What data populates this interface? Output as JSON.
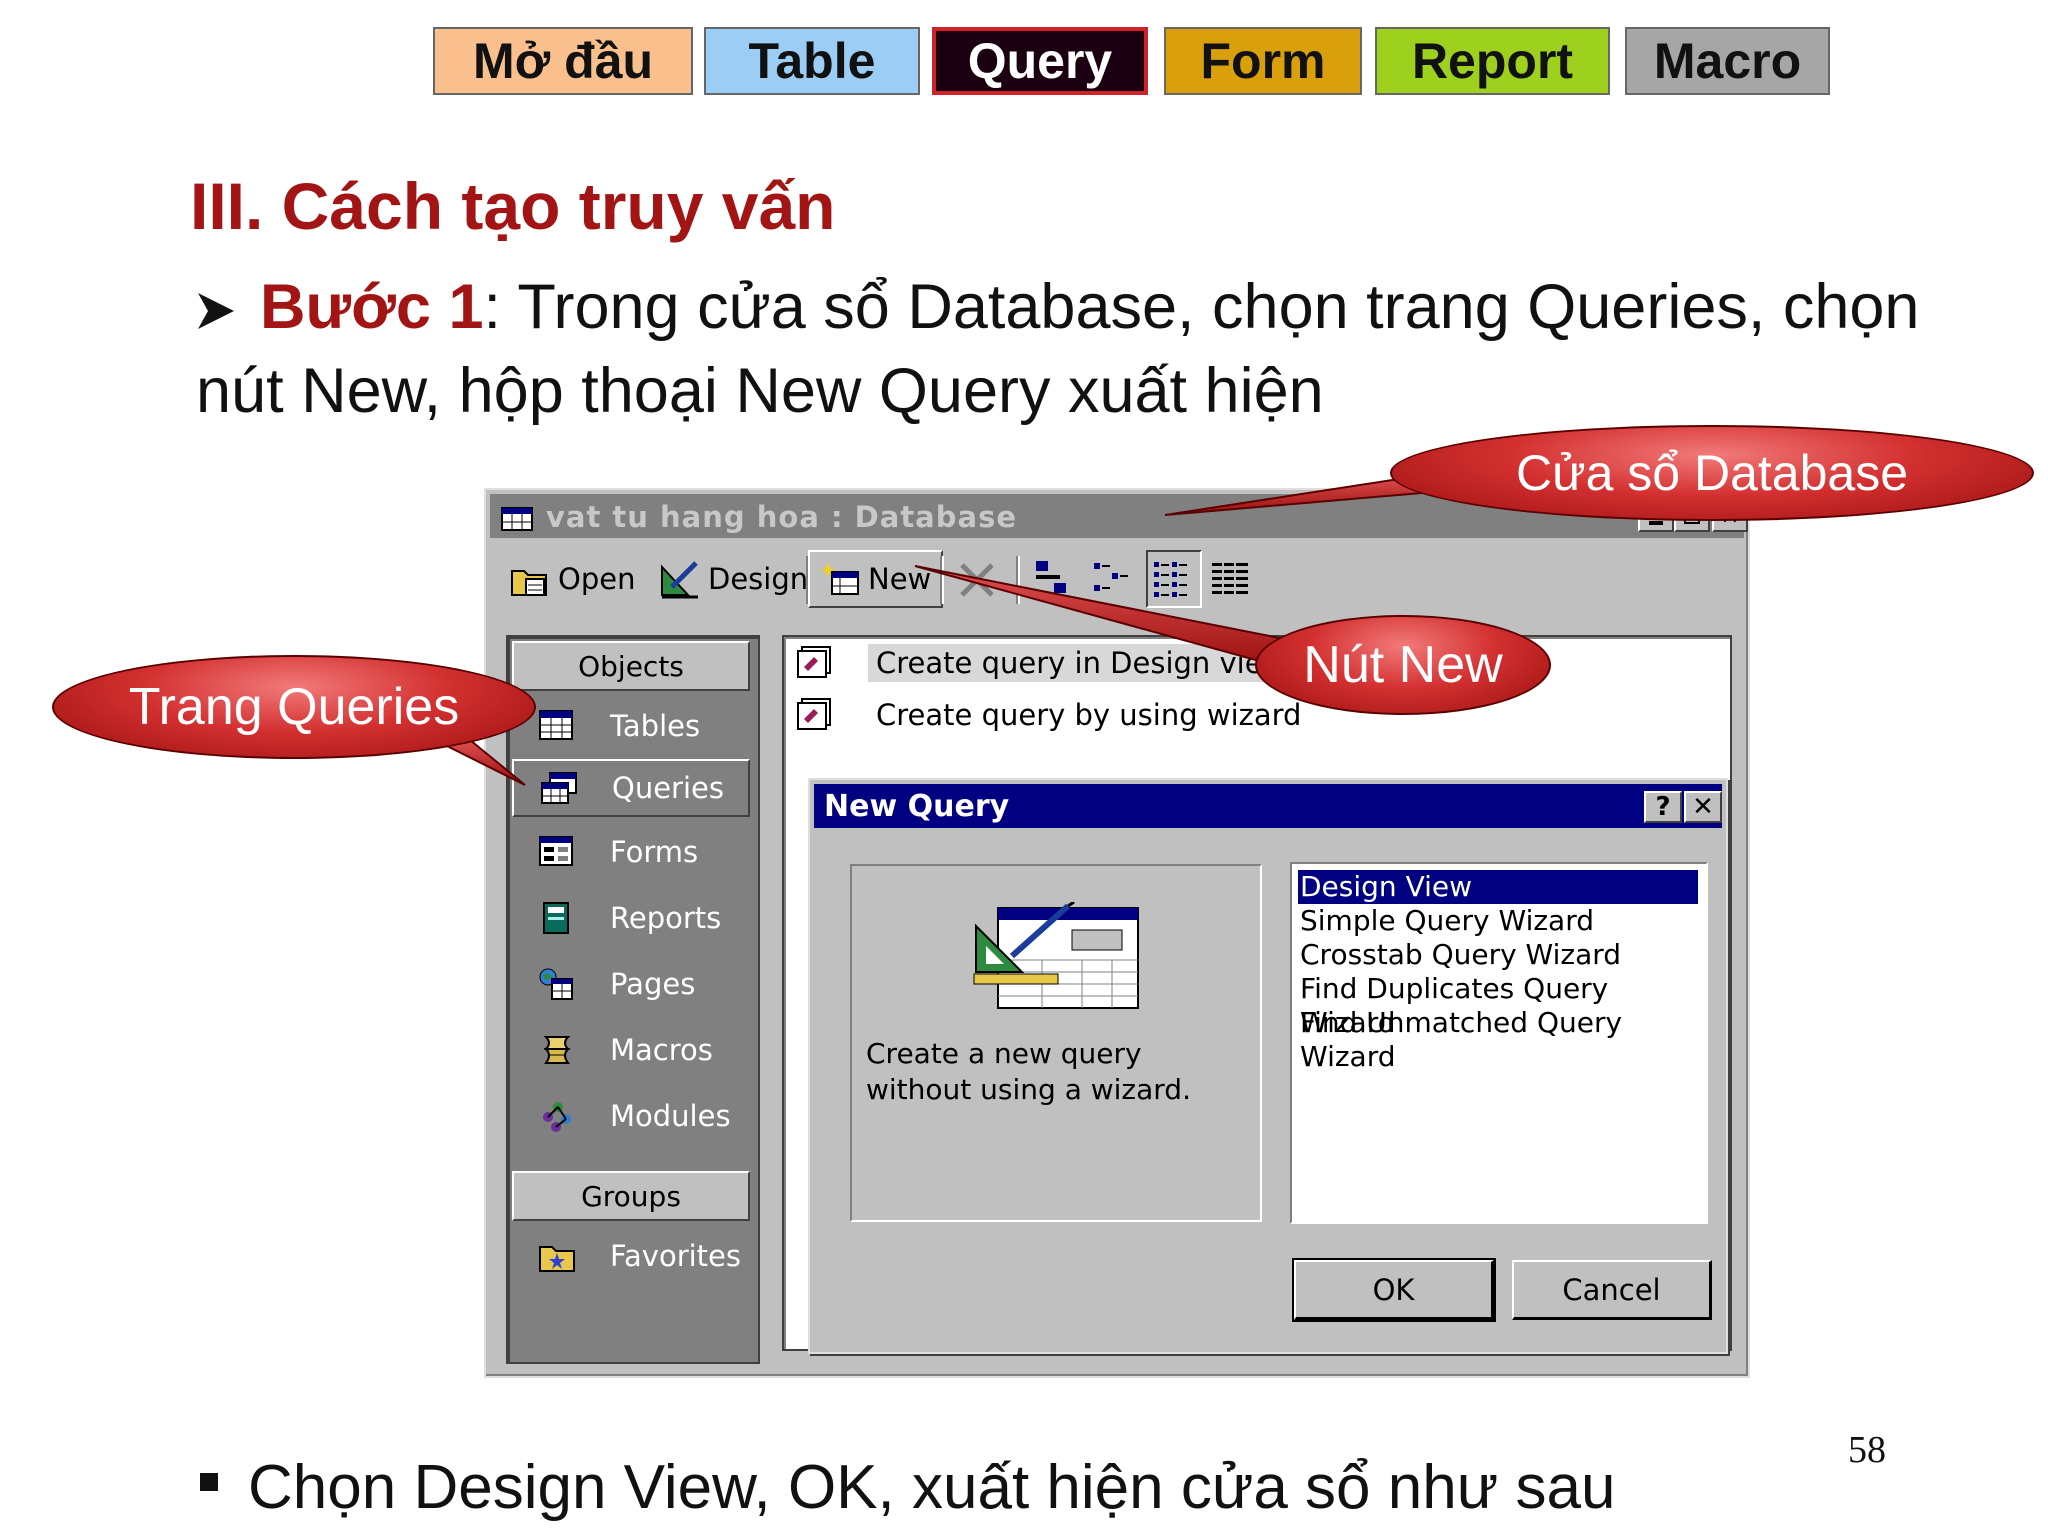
{
  "nav": {
    "tabs": [
      "Mở đầu",
      "Table",
      "Query",
      "Form",
      "Report",
      "Macro"
    ]
  },
  "title": "III. Cách tạo truy vấn",
  "step1": {
    "label": "Bước 1",
    "text": ": Trong cửa sổ Database, chọn trang Queries, chọn nút New, hộp thoại New Query xuất hiện"
  },
  "db_window": {
    "title": "vat tu hang hoa : Database",
    "toolbar": {
      "open": "Open",
      "design": "Design",
      "new": "New"
    },
    "objects_header": "Objects",
    "objects": [
      "Tables",
      "Queries",
      "Forms",
      "Reports",
      "Pages",
      "Macros",
      "Modules"
    ],
    "groups_header": "Groups",
    "groups": [
      "Favorites"
    ],
    "list_items": [
      "Create query in Design view",
      "Create query by using wizard"
    ]
  },
  "new_query": {
    "title": "New Query",
    "help": "?",
    "description": "Create a new query without using a wizard.",
    "options": [
      "Design View",
      "Simple Query Wizard",
      "Crosstab Query Wizard",
      "Find Duplicates Query Wizard",
      "Find Unmatched Query Wizard"
    ],
    "ok": "OK",
    "cancel": "Cancel"
  },
  "callouts": {
    "database_window": "Cửa sổ Database",
    "new_button": "Nút New",
    "queries_page": "Trang Queries"
  },
  "bottom_note": "Chọn Design View, OK, xuất hiện cửa sổ như sau",
  "page_number": "58",
  "colors": {
    "heading": "#a31414",
    "titlebar_active": "#000080",
    "callout": "#d33030"
  }
}
